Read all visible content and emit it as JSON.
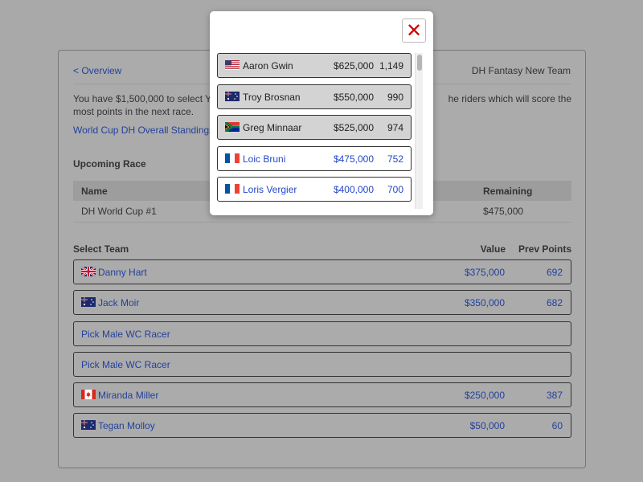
{
  "header": {
    "back_link": "< Overview",
    "page_title": "DH Fantasy New Team"
  },
  "intro": {
    "text_left": "You have $1,500,000 to select Y",
    "text_right": "he riders which will score the",
    "text_line2": "most points in the next race."
  },
  "standings_link": "World Cup DH Overall Standings",
  "upcoming_race": {
    "title": "Upcoming Race",
    "columns": [
      "Name",
      "Remaining"
    ],
    "row": {
      "name": "DH World Cup #1",
      "remaining": "$475,000"
    }
  },
  "team": {
    "title": "Select Team",
    "value_header": "Value",
    "points_header": "Prev Points",
    "rows": [
      {
        "flag": "gb",
        "name": "Danny Hart",
        "value": "$375,000",
        "points": "692"
      },
      {
        "flag": "au",
        "name": "Jack Moir",
        "value": "$350,000",
        "points": "682"
      },
      {
        "flag": "",
        "name": "Pick Male WC Racer",
        "value": "",
        "points": ""
      },
      {
        "flag": "",
        "name": "Pick Male WC Racer",
        "value": "",
        "points": ""
      },
      {
        "flag": "ca",
        "name": "Miranda Miller",
        "value": "$250,000",
        "points": "387"
      },
      {
        "flag": "au",
        "name": "Tegan Molloy",
        "value": "$50,000",
        "points": "60"
      }
    ]
  },
  "modal": {
    "close_symbol": "✕",
    "riders": [
      {
        "flag": "us",
        "name": "Aaron Gwin",
        "price": "$625,000",
        "points": "1,149",
        "state": "taken"
      },
      {
        "flag": "au",
        "name": "Troy Brosnan",
        "price": "$550,000",
        "points": "990",
        "state": "taken"
      },
      {
        "flag": "za",
        "name": "Greg Minnaar",
        "price": "$525,000",
        "points": "974",
        "state": "taken"
      },
      {
        "flag": "fr",
        "name": "Loic Bruni",
        "price": "$475,000",
        "points": "752",
        "state": "available"
      },
      {
        "flag": "fr",
        "name": "Loris Vergier",
        "price": "$400,000",
        "points": "700",
        "state": "available"
      }
    ]
  },
  "colors": {
    "overlay": "#a9a9a9",
    "link": "#23419c",
    "available_rider": "#2347c9",
    "close_red": "#cc0000"
  }
}
